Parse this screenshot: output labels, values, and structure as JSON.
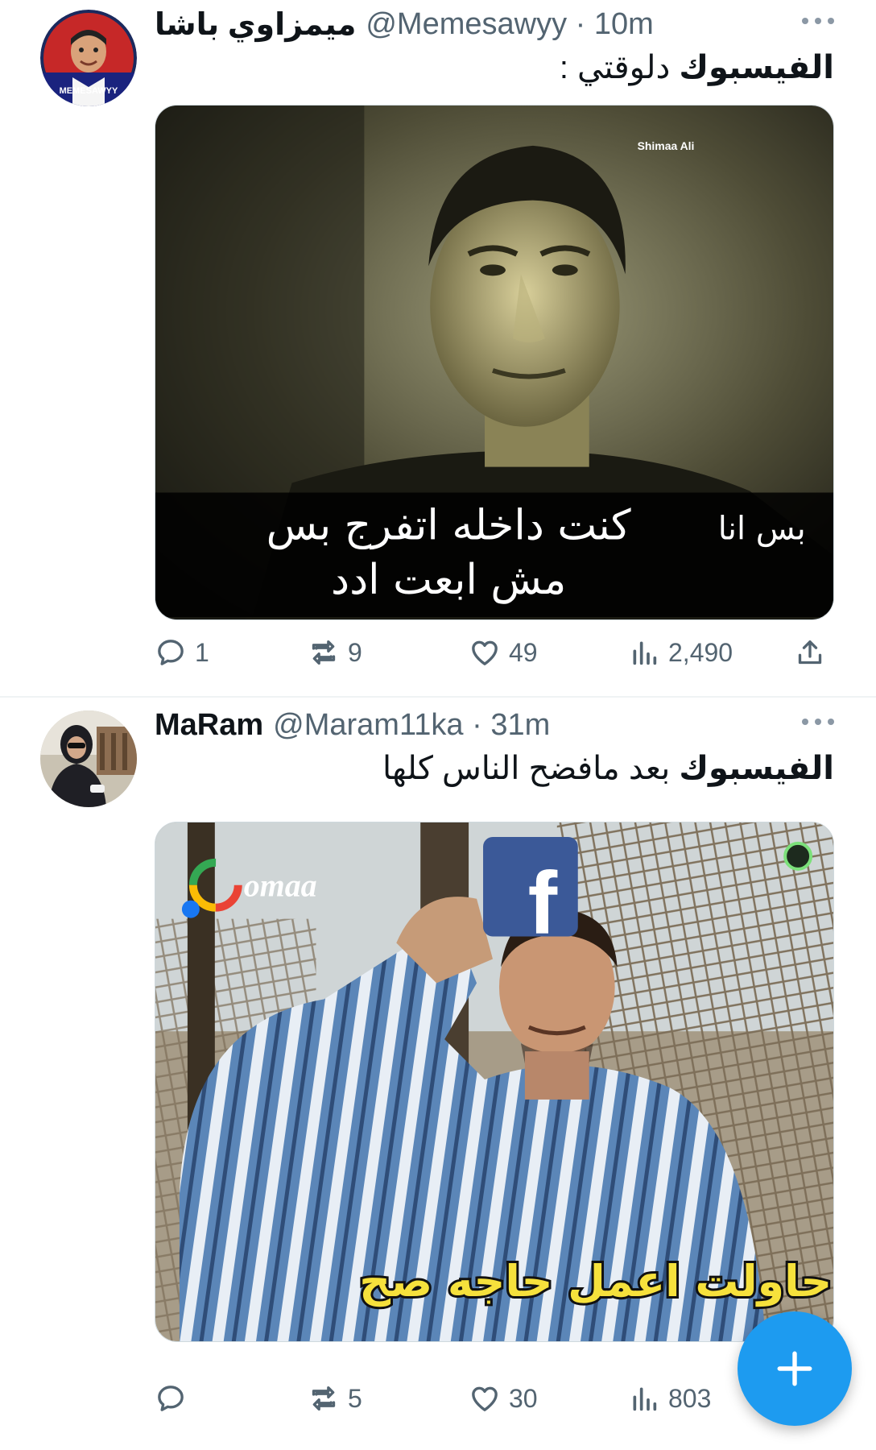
{
  "tweets": [
    {
      "display_name": "ميمزاوي باشا",
      "handle_time": "@Memesawyy · 10m",
      "text_bold": "الفيسبوك",
      "text_rest": " دلوقتي :",
      "avatar_text": "MEMESAWYY",
      "media": {
        "watermark": "Shimaa Ali",
        "caption_small": "بس انا",
        "caption_line1": "كنت داخله اتفرج بس",
        "caption_line2": "مش ابعت ادد"
      },
      "stats": {
        "replies": "1",
        "retweets": "9",
        "likes": "49",
        "views": "2,490"
      }
    },
    {
      "display_name": "MaRam",
      "handle_time": "@Maram11ka · 31m",
      "text_bold": "الفيسبوك",
      "text_rest": " بعد مافضح الناس كلها",
      "media": {
        "logo_text": "omaa",
        "logo_letter": "G",
        "fb_letter": "f",
        "caption": "حاولت اعمل حاجه صح"
      },
      "stats": {
        "replies": "",
        "retweets": "5",
        "likes": "30",
        "views": "803"
      }
    }
  ],
  "colors": {
    "accent": "#1d9bf0",
    "muted": "#536471",
    "text": "#0f1419",
    "facebook": "#3b5998"
  },
  "icons": [
    "reply-icon",
    "retweet-icon",
    "like-icon",
    "views-icon",
    "share-icon",
    "more-icon",
    "compose-icon"
  ]
}
